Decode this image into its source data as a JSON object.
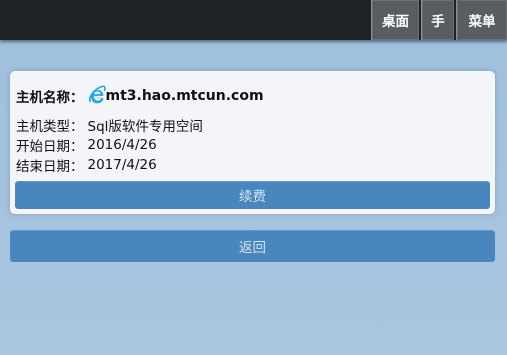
{
  "topbar": {
    "buttons": [
      {
        "label": "桌面"
      },
      {
        "label": "手"
      },
      {
        "label": "菜单"
      }
    ]
  },
  "card": {
    "host_label": "主机名称：",
    "host_icon": "ie-icon",
    "host_value": "mt3.hao.mtcun.com",
    "type_label": "主机类型：",
    "type_value": "Sql版软件专用空间",
    "start_label": "开始日期：",
    "start_value": "2016/4/26",
    "end_label": "结束日期：",
    "end_value": "2017/4/26",
    "renew_label": "续费"
  },
  "back_label": "返回",
  "colors": {
    "topbar": "#1f2326",
    "button": "#4886bd",
    "background": "#a7c4de",
    "icon": "#21a6e8"
  }
}
